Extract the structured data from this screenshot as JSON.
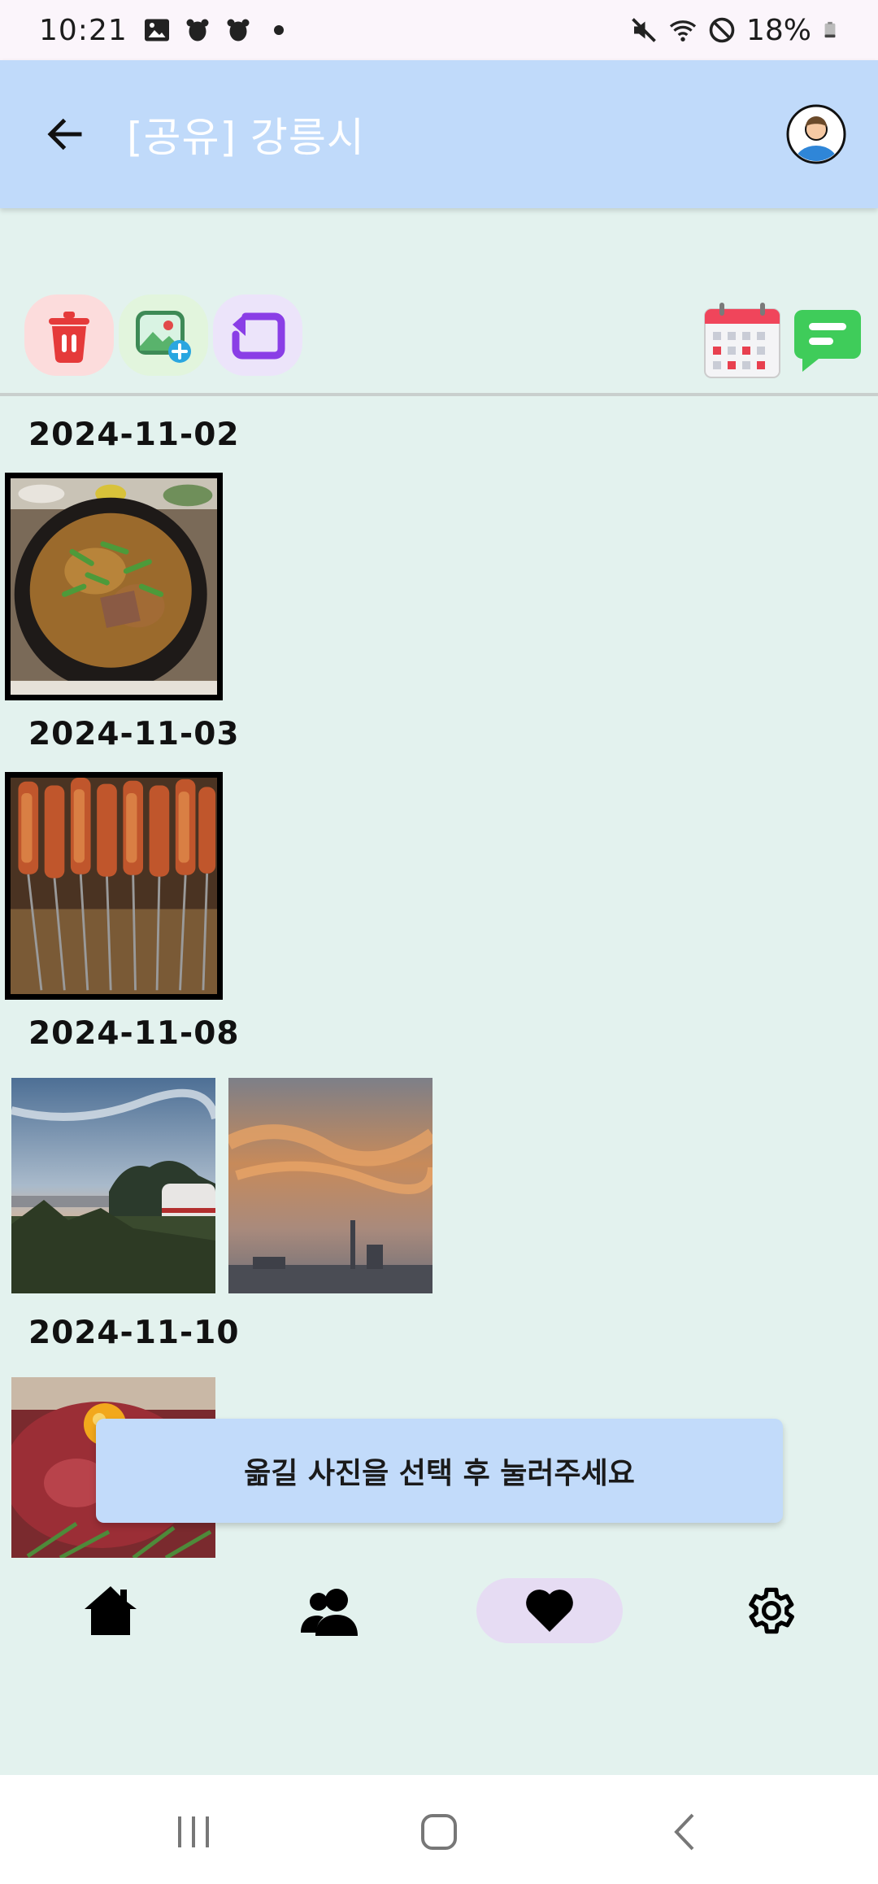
{
  "status_bar": {
    "time": "10:21",
    "battery": "18%",
    "left_icons": [
      "gallery-icon",
      "bug-icon",
      "bug-icon",
      "dot-icon"
    ],
    "right_icons": [
      "mute-icon",
      "wifi-icon",
      "dnd-icon",
      "battery-icon"
    ]
  },
  "app_bar": {
    "title": "[공유] 강릉시",
    "back_icon": "arrow-left-icon",
    "avatar_icon": "avatar-icon"
  },
  "toolbar": {
    "left": [
      "trash-icon",
      "add-photo-icon",
      "move-icon"
    ],
    "right": [
      "calendar-icon",
      "chat-icon"
    ],
    "colors": {
      "trash_bg": "#fcdcdc",
      "photo_bg": "#e2f5dd",
      "move_bg": "#ece4fa"
    }
  },
  "groups": [
    {
      "date": "2024-11-02",
      "photos": [
        {
          "name": "stew",
          "selected": true
        }
      ]
    },
    {
      "date": "2024-11-03",
      "photos": [
        {
          "name": "skewers",
          "selected": true
        }
      ]
    },
    {
      "date": "2024-11-08",
      "photos": [
        {
          "name": "sunset-camp",
          "selected": false
        },
        {
          "name": "sunset-sky",
          "selected": false
        }
      ]
    },
    {
      "date": "2024-11-10",
      "photos": [
        {
          "name": "yukhoe",
          "selected": false
        }
      ]
    }
  ],
  "toast": {
    "message": "옮길 사진을 선택 후 눌러주세요"
  },
  "bottom_nav": {
    "items": [
      "home-icon",
      "people-icon",
      "heart-icon",
      "settings-icon"
    ],
    "active": "heart-icon"
  },
  "system_nav": [
    "recents-icon",
    "home-circle-icon",
    "back-chevron-icon"
  ]
}
